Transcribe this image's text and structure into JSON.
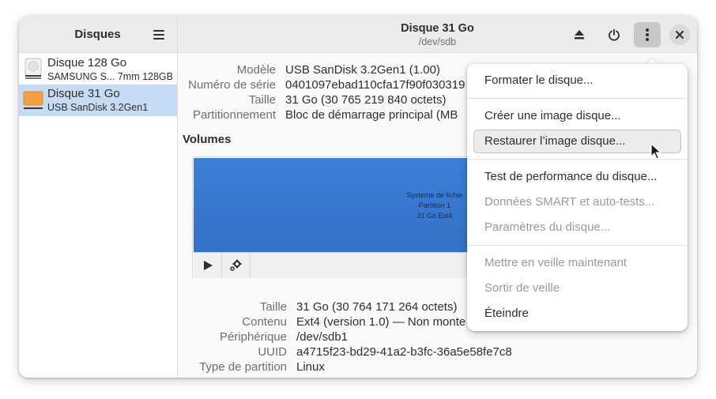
{
  "sidebar": {
    "title": "Disques",
    "disks": [
      {
        "name": "Disque 128 Go",
        "sub": "SAMSUNG S...",
        "size": "7mm 128GB"
      },
      {
        "name": "Disque 31 Go",
        "sub": "USB SanDisk 3.2Gen1",
        "size": ""
      }
    ]
  },
  "header": {
    "title": "Disque 31 Go",
    "subtitle": "/dev/sdb"
  },
  "drive": {
    "model_label": "Modèle",
    "model_value": "USB SanDisk 3.2Gen1 (1.00)",
    "serial_label": "Numéro de série",
    "serial_value": "0401097ebad110cfa17f90f030319",
    "size_label": "Taille",
    "size_value": "31 Go (30 765 219 840 octets)",
    "partitioning_label": "Partitionnement",
    "partitioning_value": "Bloc de démarrage principal (MB"
  },
  "volumes": {
    "title": "Volumes",
    "bar_label_line1": "Système de fichie",
    "bar_label_line2": "Partition 1",
    "bar_label_line3": "31 Go Ext4",
    "bar_color": "#3a7bd5"
  },
  "volume_props": {
    "size_label": "Taille",
    "size_value": "31 Go (30 764 171 264 octets)",
    "content_label": "Contenu",
    "content_value": "Ext4 (version 1.0) — Non monte",
    "device_label": "Périphérique",
    "device_value": "/dev/sdb1",
    "uuid_label": "UUID",
    "uuid_value": "a4715f23-bd29-41a2-b3fc-36a5e58fe7c8",
    "parttype_label": "Type de partition",
    "parttype_value": "Linux"
  },
  "menu": {
    "format": "Formater le disque...",
    "create_image": "Créer une image disque...",
    "restore_image": "Restaurer l’image disque...",
    "benchmark": "Test de performance du disque...",
    "smart": "Données SMART et auto-tests...",
    "settings": "Paramètres du disque...",
    "standby": "Mettre en veille maintenant",
    "wakeup": "Sortir de veille",
    "poweroff": "Éteindre"
  },
  "colors": {
    "selection": "#c7dbf5",
    "usb_icon": "#f5a040"
  }
}
